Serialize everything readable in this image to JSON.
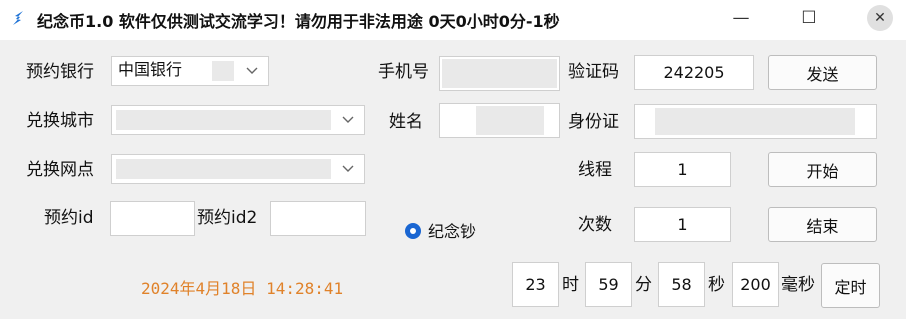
{
  "window": {
    "title": "纪念币1.0  软件仅供测试交流学习！请勿用于非法用途  0天0小时0分-1秒",
    "icon": "app-logo-icon",
    "minimize_glyph": "—",
    "maximize_glyph": "☐",
    "close_glyph": "✕"
  },
  "form": {
    "bank_label": "预约银行",
    "bank_value": "中国银行",
    "city_label": "兑换城市",
    "city_value": "",
    "branch_label": "兑换网点",
    "branch_value": "",
    "id_label": "预约id",
    "id_value": "",
    "id2_label": "预约id2",
    "id2_value": "",
    "phone_label": "手机号",
    "phone_value": "",
    "name_label": "姓名",
    "name_value": "",
    "code_label": "验证码",
    "code_value": "242205",
    "send_button": "发送",
    "idcard_label": "身份证",
    "idcard_value": "",
    "threads_label": "线程",
    "threads_value": "1",
    "start_button": "开始",
    "count_label": "次数",
    "count_value": "1",
    "end_button": "结束",
    "radio_label": "纪念钞",
    "radio_checked": true
  },
  "status": {
    "datetime": "2024年4月18日 14:28:41",
    "color": "#e0822a"
  },
  "timer": {
    "hours": "23",
    "hours_unit": "时",
    "minutes": "59",
    "minutes_unit": "分",
    "seconds": "58",
    "seconds_unit": "秒",
    "ms": "200",
    "ms_unit": "毫秒",
    "button": "定时"
  }
}
